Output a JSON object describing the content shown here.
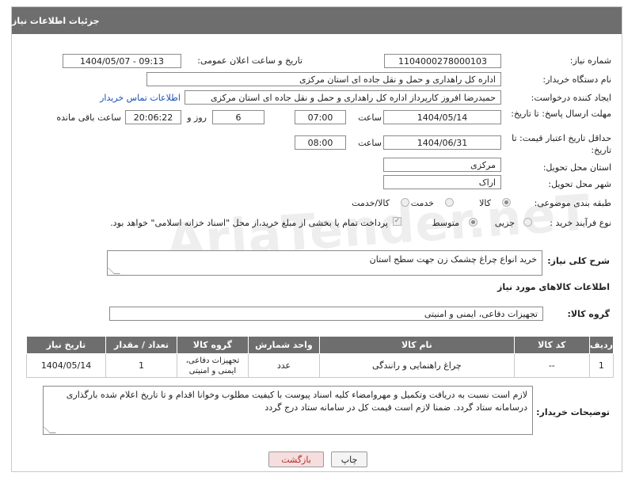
{
  "header": {
    "title": "جزئیات اطلاعات نیاز"
  },
  "form": {
    "need_number": {
      "label": "شماره نیاز:",
      "value": "1104000278000103"
    },
    "announce": {
      "label": "تاریخ و ساعت اعلان عمومی:",
      "value": "1404/05/07 - 09:13"
    },
    "buyer_org": {
      "label": "نام دستگاه خریدار:",
      "value": "اداره کل راهداری و حمل و نقل جاده ای استان مرکزی"
    },
    "requester": {
      "label": "ایجاد کننده درخواست:",
      "value": "حمیدرضا  افروز  کارپرداز اداره کل راهداری و حمل و نقل جاده ای استان مرکزی",
      "contact_link": "اطلاعات تماس خریدار"
    },
    "reply_deadline": {
      "label": "مهلت ارسال پاسخ: تا تاریخ:",
      "date": "1404/05/14",
      "time_label": "ساعت",
      "time": "07:00",
      "days": "6",
      "days_label": "روز و",
      "remaining": "20:06:22",
      "remaining_label": "ساعت باقی مانده"
    },
    "price_validity": {
      "label": "حداقل تاریخ اعتبار قیمت: تا تاریخ:",
      "date": "1404/06/31",
      "time_label": "ساعت",
      "time": "08:00"
    },
    "province": {
      "label": "استان محل تحویل:",
      "value": "مرکزی"
    },
    "city": {
      "label": "شهر محل تحویل:",
      "value": "اراک"
    },
    "category": {
      "label": "طبقه بندی موضوعی:",
      "options": [
        "کالا",
        "خدمت",
        "کالا/خدمت"
      ],
      "selected": "کالا"
    },
    "process": {
      "label": "نوع فرآیند خرید :",
      "options": [
        "جزیی",
        "متوسط"
      ],
      "selected": "متوسط",
      "payment_note": "پرداخت تمام یا بخشی از مبلغ خرید،از محل \"اسناد خزانه اسلامی\" خواهد بود."
    }
  },
  "description": {
    "label": "شرح کلی نیاز:",
    "value": "خرید انواع چراغ چشمک زن جهت سطح استان"
  },
  "goods_section": {
    "title": "اطلاعات کالاهای مورد نیاز"
  },
  "goods_group": {
    "label": "گروه کالا:",
    "value": "تجهیزات دفاعی، ایمنی و امنیتی"
  },
  "table": {
    "headers": [
      "ردیف",
      "کد کالا",
      "نام کالا",
      "واحد شمارش",
      "گروه کالا",
      "تعداد / مقدار",
      "تاریخ نیاز"
    ],
    "rows": [
      [
        "1",
        "--",
        "چراغ راهنمایی و رانندگی",
        "عدد",
        "تجهیزات دفاعی، ایمنی و امنیتی",
        "1",
        "1404/05/14"
      ]
    ]
  },
  "buyer_notes": {
    "label": "توضیحات خریدار:",
    "value": "لازم است نسبت به دریافت وتکمیل و مهروامضاء کلیه اسناد پیوست با کیفیت مطلوب وخوانا اقدام و تا تاریخ اعلام شده بارگذاری درسامانه ستاد گردد. ضمنا لازم است قیمت کل در سامانه ستاد درج گردد"
  },
  "buttons": {
    "print": "چاپ",
    "back": "بازگشت"
  },
  "watermark": "AriaTender.neT",
  "colors": {
    "header_bg": "#6e6e6e",
    "link": "#1a4fb5",
    "back_btn_bg": "#f6dede"
  }
}
